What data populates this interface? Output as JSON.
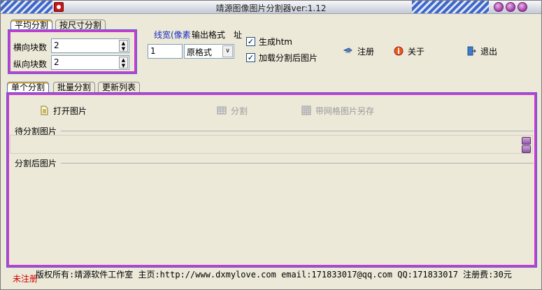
{
  "window": {
    "title": "靖源图像图片分割器ver:1.12",
    "controls": [
      "◯",
      "◯",
      "◯"
    ]
  },
  "split_mode_tabs": [
    {
      "label": "平均分割",
      "active": true
    },
    {
      "label": "按尺寸分割",
      "active": false
    }
  ],
  "average_split": {
    "horizontal_label": "横向块数",
    "horizontal_value": "2",
    "vertical_label": "纵向块数",
    "vertical_value": "2"
  },
  "line_width": {
    "label": "线宽(像素",
    "value": "1"
  },
  "output_format": {
    "label": "输出格式",
    "selected": "原格式"
  },
  "address_label": "址",
  "options": {
    "generate_htm": {
      "label": "生成htm",
      "checked": true
    },
    "load_split": {
      "label": "加载分割后图片",
      "checked": true
    }
  },
  "toolbar": {
    "register": "注册",
    "about": "关于",
    "exit": "退出"
  },
  "main_tabs": [
    {
      "label": "单个分割",
      "active": true
    },
    {
      "label": "批量分割",
      "active": false
    },
    {
      "label": "更新列表",
      "active": false
    }
  ],
  "actions": {
    "open_image": "打开图片",
    "split": "分割",
    "save_grid": "带网格图片另存"
  },
  "sections": {
    "pending": "待分割图片",
    "after": "分割后图片"
  },
  "status": {
    "unregistered": "未注册",
    "copyright": "版权所有:靖源软件工作室 主页:http://www.dxmylove.com email:171833017@qq.com QQ:171833017 注册费:30元"
  },
  "colors": {
    "highlight_border": "#c63bd1",
    "accent_blue": "#4a66c6",
    "status_red": "#d00000"
  }
}
